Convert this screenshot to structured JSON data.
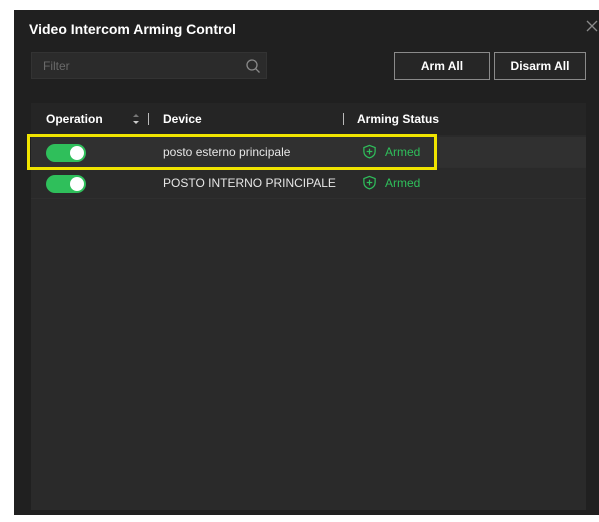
{
  "dialog": {
    "title": "Video Intercom Arming Control",
    "close_icon": "close-icon"
  },
  "filter": {
    "placeholder": "Filter",
    "value": "",
    "icon": "search-icon"
  },
  "buttons": {
    "arm_all": "Arm All",
    "disarm_all": "Disarm All"
  },
  "table": {
    "columns": [
      "Operation",
      "Device",
      "Arming Status"
    ],
    "rows": [
      {
        "operation_on": true,
        "device": "posto esterno principale",
        "status": "Armed",
        "highlighted": true
      },
      {
        "operation_on": true,
        "device": "POSTO INTERNO PRINCIPALE",
        "status": "Armed",
        "highlighted": false
      }
    ]
  },
  "colors": {
    "accent_green": "#2fbf5b",
    "highlight": "#f0e400",
    "background": "#202020"
  }
}
